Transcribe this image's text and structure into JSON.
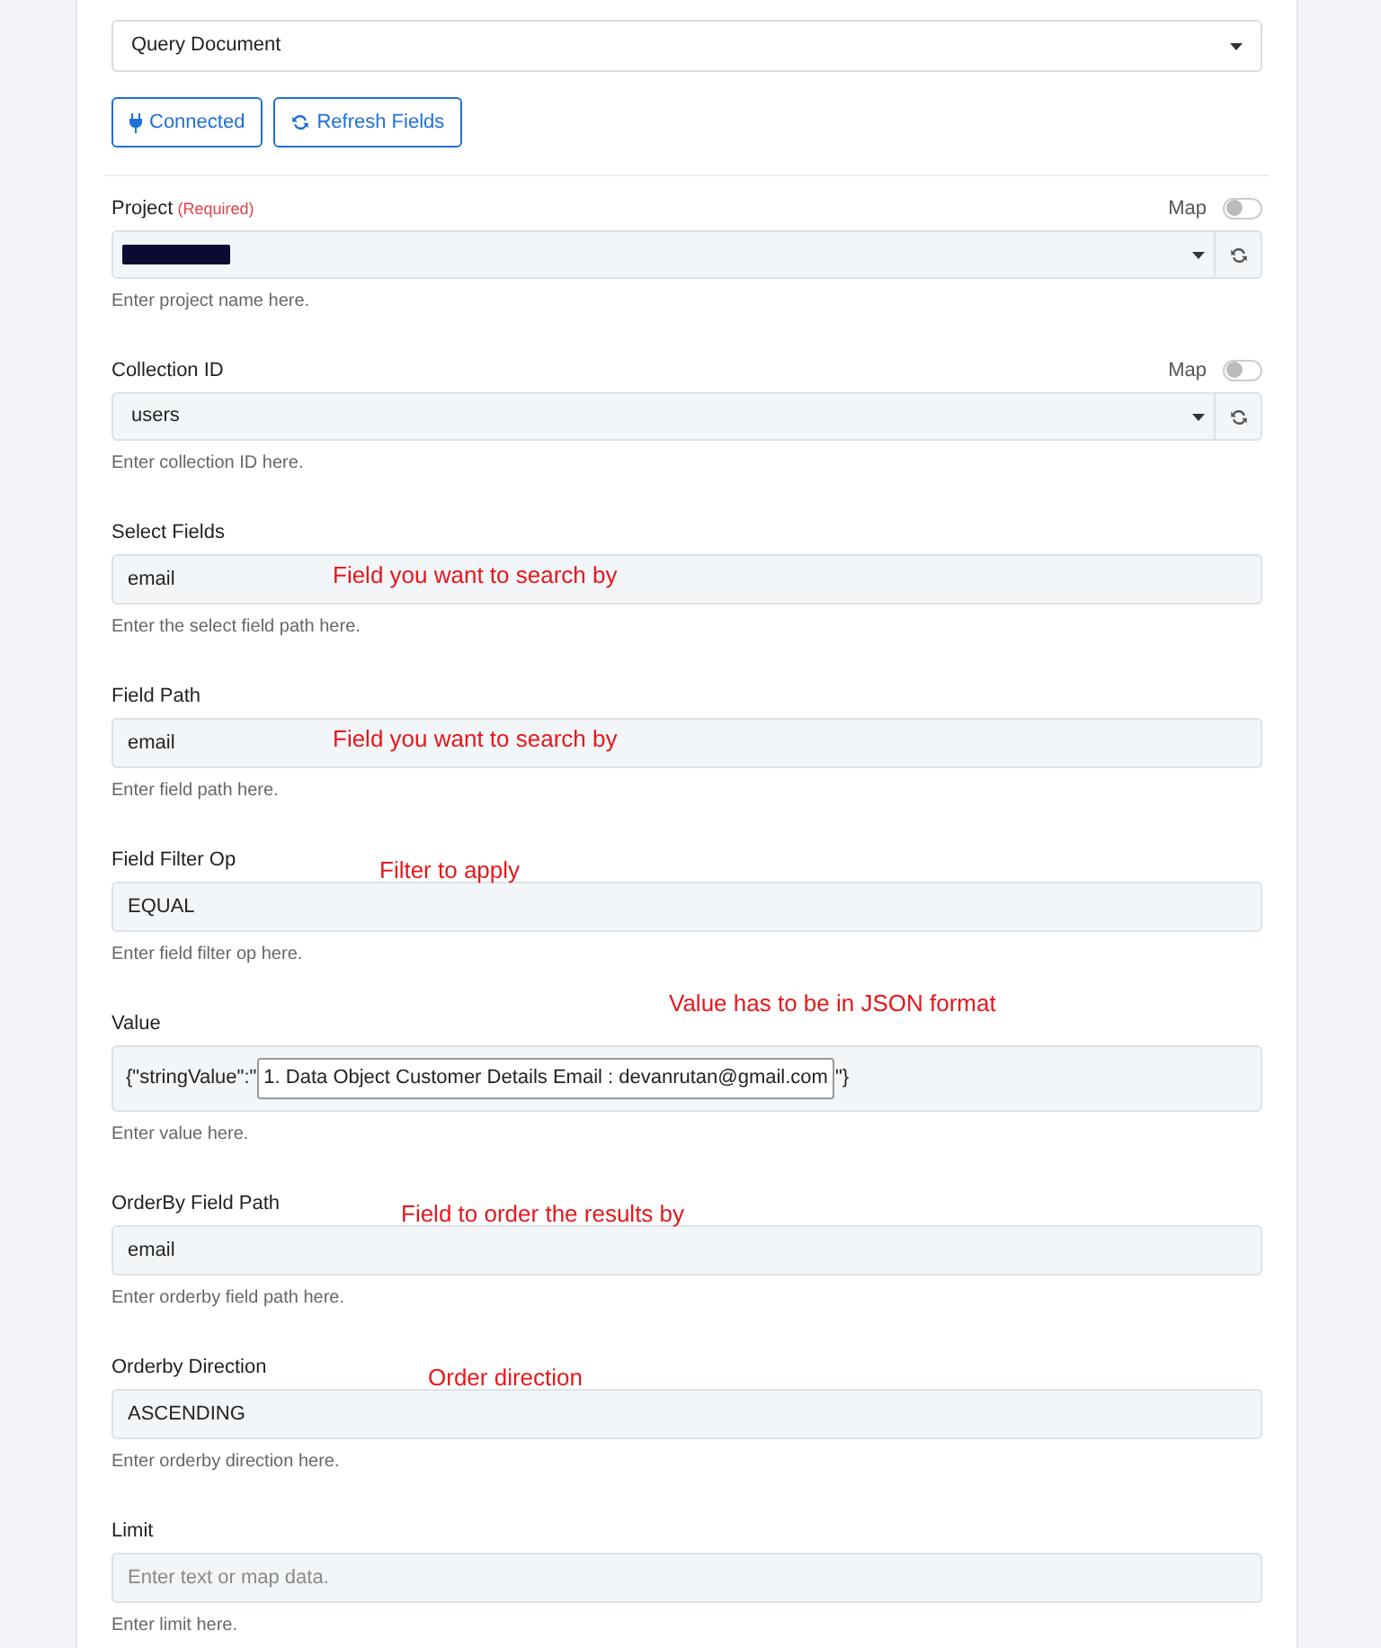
{
  "action_event": {
    "value": "Query Document"
  },
  "buttons": [
    {
      "kind": "connected",
      "label": "Connected"
    },
    {
      "kind": "refresh",
      "label": "Refresh Fields"
    }
  ],
  "fields": [
    {
      "kind": "select",
      "label": "Project",
      "required": "(Required)",
      "map_label": "Map",
      "map_on": false,
      "redacted": true,
      "help": "Enter project name here."
    },
    {
      "kind": "select",
      "label": "Collection ID",
      "map_label": "Map",
      "map_on": false,
      "value": "users",
      "help": "Enter collection ID here."
    },
    {
      "kind": "text",
      "label": "Select Fields",
      "value": "email",
      "note": "Field you want to search by",
      "help": "Enter the select field path here."
    },
    {
      "kind": "text",
      "label": "Field Path",
      "value": "email",
      "note": "Field you want to search by",
      "help": "Enter field path here."
    },
    {
      "kind": "text",
      "label": "Field Filter Op",
      "value": "EQUAL",
      "note": "Filter to apply",
      "help": "Enter field filter op here."
    },
    {
      "kind": "json",
      "label": "Value",
      "prefix": "{\"stringValue\":\"",
      "token": "1. Data Object Customer Details Email : devanrutan@gmail.com",
      "suffix": "\"}",
      "note": "Value has to be in JSON format",
      "help": "Enter value here."
    },
    {
      "kind": "text",
      "label": "OrderBy Field Path",
      "value": "email",
      "note": "Field to order the results by",
      "help": "Enter orderby field path here."
    },
    {
      "kind": "text",
      "label": "Orderby Direction",
      "value": "ASCENDING",
      "note": "Order direction",
      "help": "Enter orderby direction here."
    },
    {
      "kind": "text",
      "label": "Limit",
      "placeholder": "Enter text or map data.",
      "help": "Enter limit here."
    }
  ]
}
